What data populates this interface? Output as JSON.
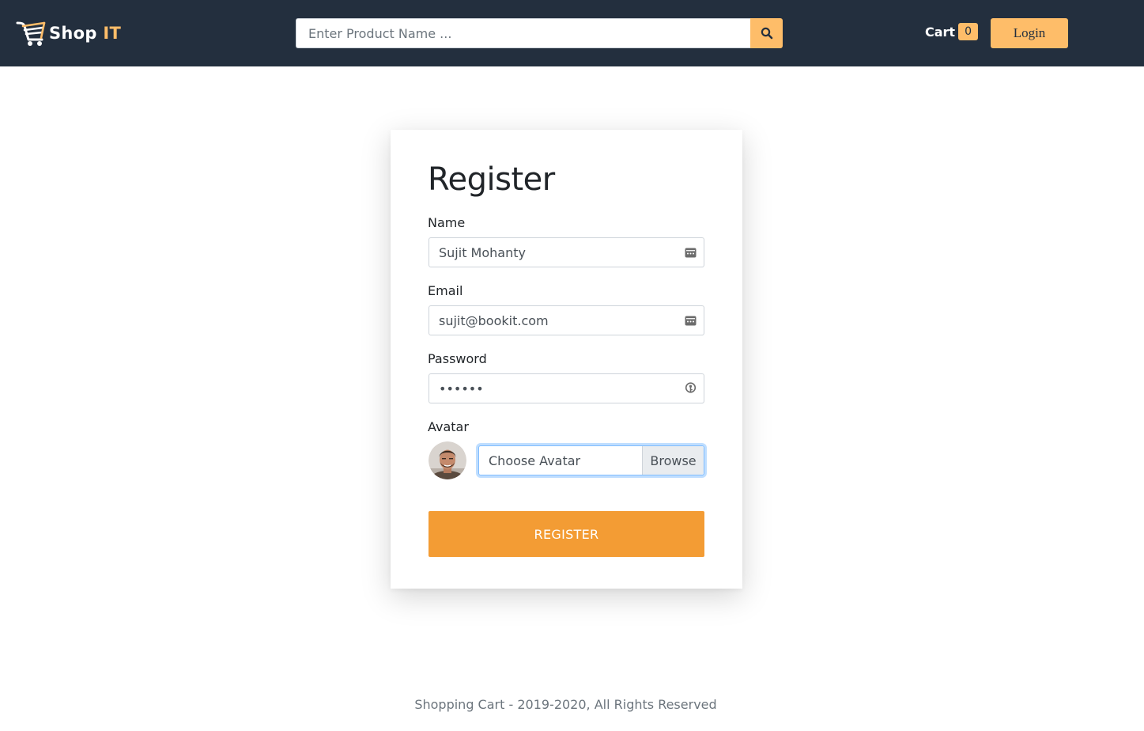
{
  "header": {
    "logo_text": "Shop",
    "logo_accent": "IT",
    "search_placeholder": "Enter Product Name ...",
    "search_icon": "search-icon",
    "cart_label": "Cart",
    "cart_count": "0",
    "login_label": "Login"
  },
  "form": {
    "title": "Register",
    "name_label": "Name",
    "name_value": "Sujit Mohanty",
    "email_label": "Email",
    "email_value": "sujit@bookit.com",
    "password_label": "Password",
    "password_value": "••••••",
    "avatar_label": "Avatar",
    "choose_avatar": "Choose Avatar",
    "browse_label": "Browse",
    "register_label": "REGISTER"
  },
  "footer": {
    "text": "Shopping Cart - 2019-2020, All Rights Reserved"
  },
  "colors": {
    "navbar": "#232f3e",
    "accent": "#febd69",
    "register_button": "#f39c34"
  }
}
